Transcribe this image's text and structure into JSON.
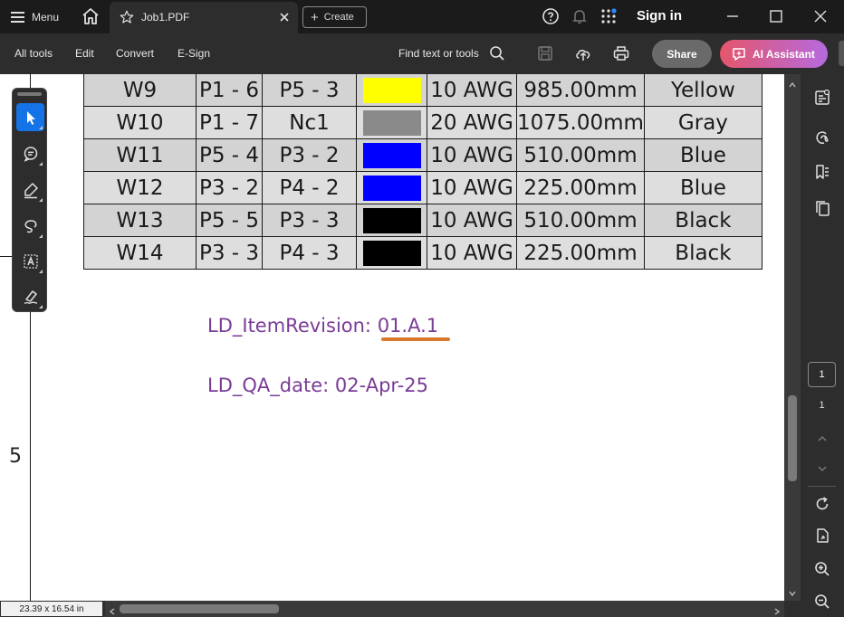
{
  "titlebar": {
    "menu_label": "Menu",
    "tab_title": "Job1.PDF",
    "create_label": "Create",
    "signin_label": "Sign in"
  },
  "toolbar": {
    "items": [
      "All tools",
      "Edit",
      "Convert",
      "E-Sign"
    ],
    "find_label": "Find text or tools",
    "share_label": "Share",
    "ai_label": "AI Assistant"
  },
  "wire_table": {
    "rows": [
      {
        "id": "W9",
        "from": "P1 - 6",
        "to": "P5 - 3",
        "swatch": "#ffff00",
        "gauge": "10 AWG",
        "length": "985.00mm",
        "color": "Yellow"
      },
      {
        "id": "W10",
        "from": "P1 - 7",
        "to": "Nc1",
        "swatch": "#8a8a8a",
        "gauge": "20 AWG",
        "length": "1075.00mm",
        "color": "Gray"
      },
      {
        "id": "W11",
        "from": "P5 - 4",
        "to": "P3 - 2",
        "swatch": "#0000ff",
        "gauge": "10 AWG",
        "length": "510.00mm",
        "color": "Blue"
      },
      {
        "id": "W12",
        "from": "P3 - 2",
        "to": "P4 - 2",
        "swatch": "#0000ff",
        "gauge": "10 AWG",
        "length": "225.00mm",
        "color": "Blue"
      },
      {
        "id": "W13",
        "from": "P5 - 5",
        "to": "P3 - 3",
        "swatch": "#000000",
        "gauge": "10 AWG",
        "length": "510.00mm",
        "color": "Black"
      },
      {
        "id": "W14",
        "from": "P3 - 3",
        "to": "P4 - 3",
        "swatch": "#000000",
        "gauge": "10 AWG",
        "length": "225.00mm",
        "color": "Black"
      }
    ]
  },
  "document": {
    "item_revision": "LD_ItemRevision: 01.A.1",
    "qa_date": "LD_QA_date: 02-Apr-25",
    "margin_number": "5"
  },
  "floating_tools": [
    "select-tool",
    "comment-tool",
    "highlight-tool",
    "draw-tool",
    "text-recognition-tool",
    "sign-tool"
  ],
  "right_panel": {
    "current_page": "1",
    "total_pages": "1"
  },
  "statusbar": {
    "page_dimensions": "23.39 x 16.54 in"
  },
  "colors": {
    "accent": "#1473e6",
    "meta_text": "#7a3b97",
    "underline": "#d9782a"
  }
}
